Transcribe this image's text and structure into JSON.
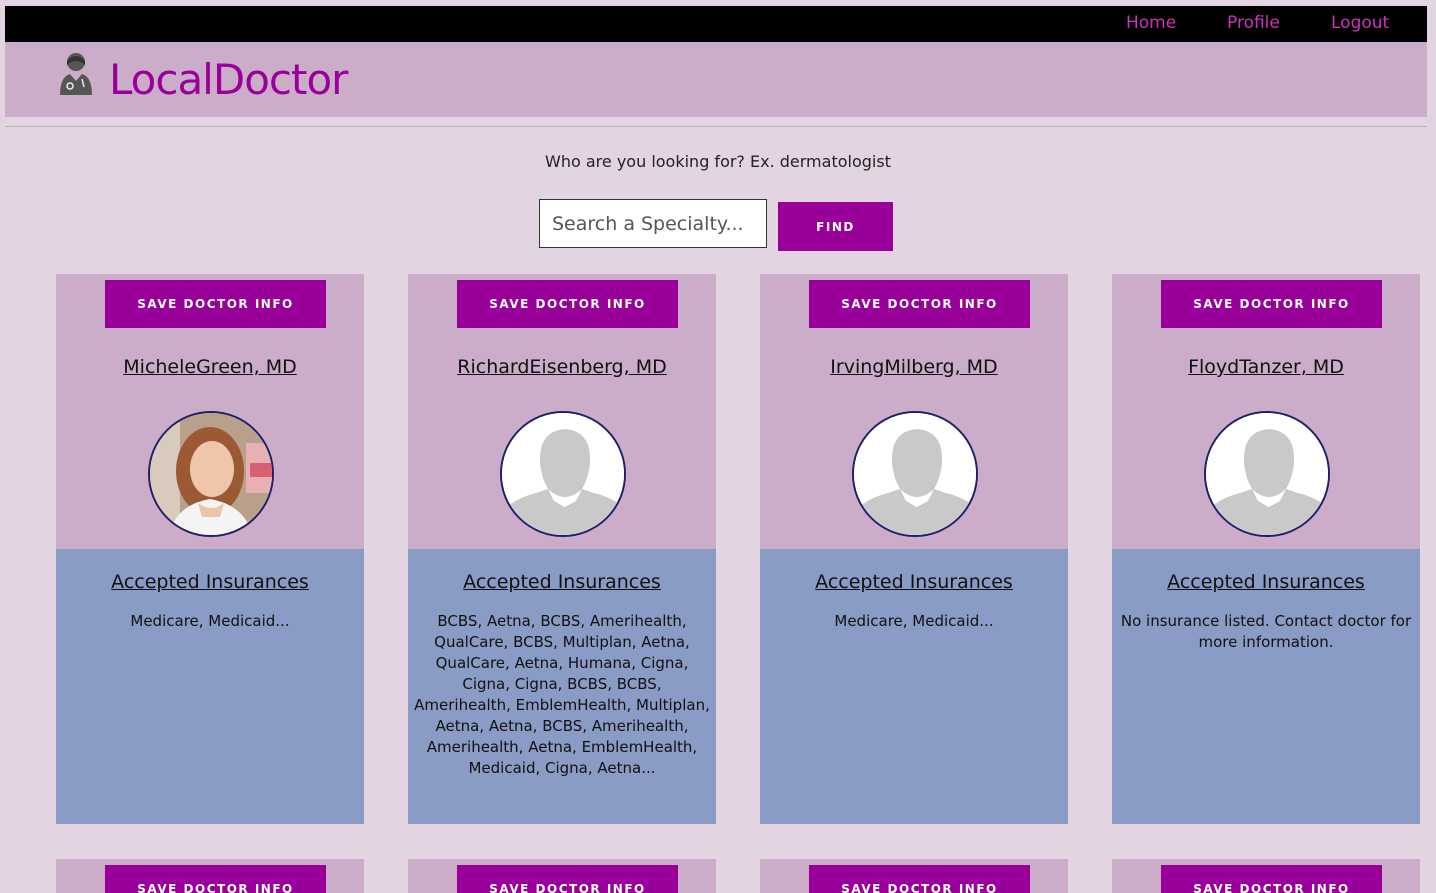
{
  "nav": {
    "home": "Home",
    "profile": "Profile",
    "logout": "Logout"
  },
  "brand": {
    "title": "LocalDoctor",
    "icon": "doctor-icon"
  },
  "search": {
    "prompt": "Who are you looking for? Ex. dermatologist",
    "placeholder": "Search a Specialty...",
    "button": "FIND"
  },
  "colors": {
    "accent": "#990099",
    "card_top": "#cbadc9",
    "card_bottom": "#8a9bc6",
    "background": "#e2d5e1"
  },
  "cards": [
    {
      "save_label": "SAVE DOCTOR INFO",
      "name": "MicheleGreen, MD",
      "photo": "photo",
      "insurance_title": "Accepted Insurances",
      "insurances": "Medicare, Medicaid..."
    },
    {
      "save_label": "SAVE DOCTOR INFO",
      "name": "RichardEisenberg, MD",
      "photo": "placeholder",
      "insurance_title": "Accepted Insurances",
      "insurances": "BCBS, Aetna, BCBS, Amerihealth, QualCare, BCBS, Multiplan, Aetna, QualCare, Aetna, Humana, Cigna, Cigna, Cigna, BCBS, BCBS, Amerihealth, EmblemHealth, Multiplan, Aetna, Aetna, BCBS, Amerihealth, Amerihealth, Aetna, EmblemHealth, Medicaid, Cigna, Aetna..."
    },
    {
      "save_label": "SAVE DOCTOR INFO",
      "name": "IrvingMilberg, MD",
      "photo": "placeholder",
      "insurance_title": "Accepted Insurances",
      "insurances": "Medicare, Medicaid..."
    },
    {
      "save_label": "SAVE DOCTOR INFO",
      "name": "FloydTanzer, MD",
      "photo": "placeholder",
      "insurance_title": "Accepted Insurances",
      "insurances": "No insurance listed. Contact doctor for more information."
    }
  ],
  "second_row_save_label": "SAVE DOCTOR INFO"
}
